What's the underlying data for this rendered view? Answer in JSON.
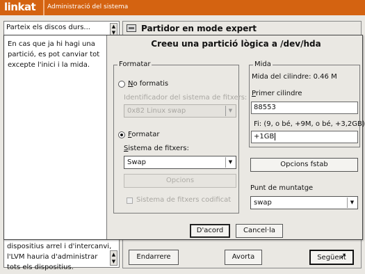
{
  "topbar": {
    "brand": "linkat",
    "title": "Administració del sistema",
    "color": "#d46311"
  },
  "help_panel": {
    "title": "Parteix els discos durs...",
    "bottom_lines": [
      "dispositius arrel i d'intercanvi,",
      "l'LVM hauria d'administrar",
      "tots els dispositius."
    ]
  },
  "expert_panel": {
    "title": "Partidor en mode expert",
    "icon": "disk-icon",
    "back_label": "Endarrere",
    "abort_label": "Avorta",
    "next_label": "Següent"
  },
  "dialog": {
    "title": "Creeu una partició lògica a /dev/hda",
    "help_lines": [
      "En cas que ja hi hagi una",
      "partició, es pot canviar tot",
      "excepte l'inici i la mida."
    ],
    "format_group": {
      "legend": "Formatar",
      "no_format": {
        "label": "No formatis",
        "checked": false
      },
      "fs_identifier_label": "Identificador del sistema de fitxers:",
      "fs_identifier_value": "0x82 Linux swap",
      "format": {
        "label": "Formatar",
        "checked": true
      },
      "fs_label": "Sistema de fitxers:",
      "fs_value": "Swap",
      "options_label": "Opcions",
      "encrypted_label": "Sistema de fitxers codificat",
      "encrypted_checked": false
    },
    "size_group": {
      "legend": "Mida",
      "cylinder_size": "Mida del cilindre: 0.46 M",
      "first_cylinder_label": "Primer cilindre",
      "first_cylinder_value": "88553",
      "end_label": "Fi:  (9, o bé, +9M, o bé, +3,2GB)",
      "end_value": "+1GB"
    },
    "fstab_options_label": "Opcions fstab",
    "mountpoint_label": "Punt de muntatge",
    "mountpoint_value": "swap",
    "ok_label": "D'acord",
    "cancel_label": "Cancel·la"
  }
}
